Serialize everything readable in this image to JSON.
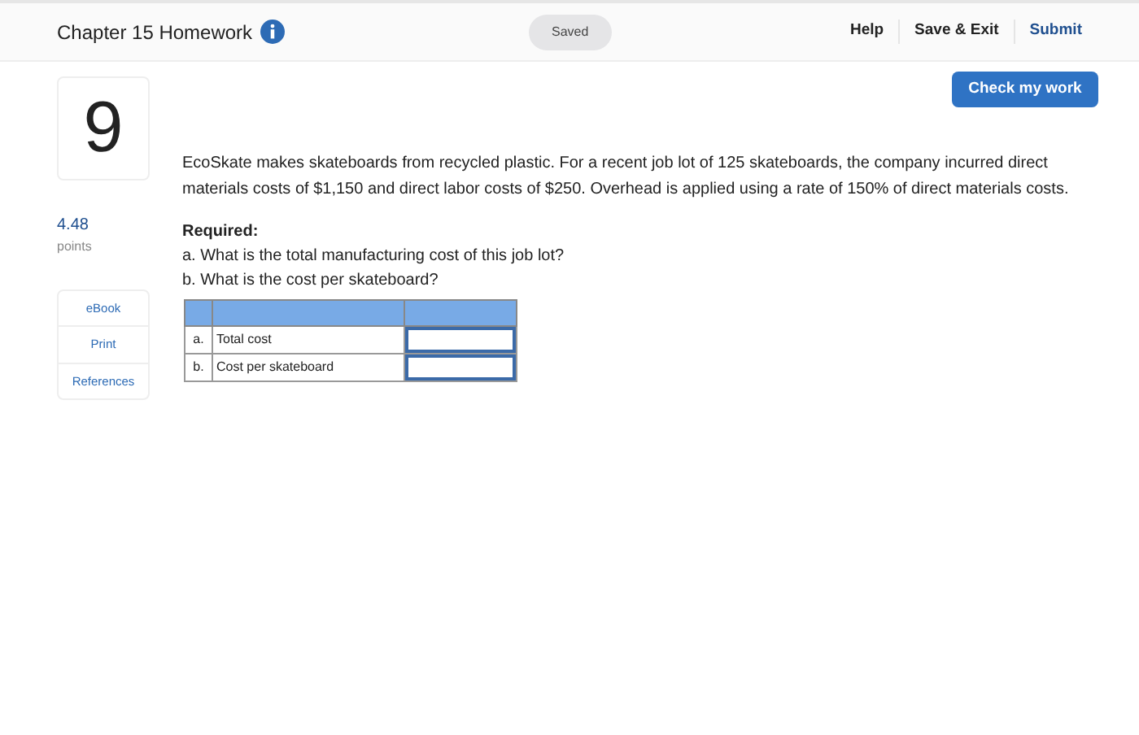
{
  "header": {
    "title": "Chapter 15 Homework",
    "status": "Saved",
    "links": [
      "Help",
      "Save & Exit",
      "Submit"
    ]
  },
  "check_button": "Check my work",
  "question": {
    "number": "9",
    "points": "4.48",
    "points_label": "points"
  },
  "resources": [
    "eBook",
    "Print",
    "References"
  ],
  "problem": "EcoSkate makes skateboards from recycled plastic. For a recent job lot of 125 skateboards, the company incurred direct materials costs of $1,150 and direct labor costs of $250. Overhead is applied using a rate of 150% of direct materials costs.",
  "required": {
    "heading": "Required:",
    "items": [
      "a. What is the total manufacturing cost of this job lot?",
      "b. What is the cost per skateboard?"
    ]
  },
  "table": {
    "rows": [
      {
        "letter": "a.",
        "label": "Total cost"
      },
      {
        "letter": "b.",
        "label": "Cost per skateboard"
      }
    ]
  }
}
